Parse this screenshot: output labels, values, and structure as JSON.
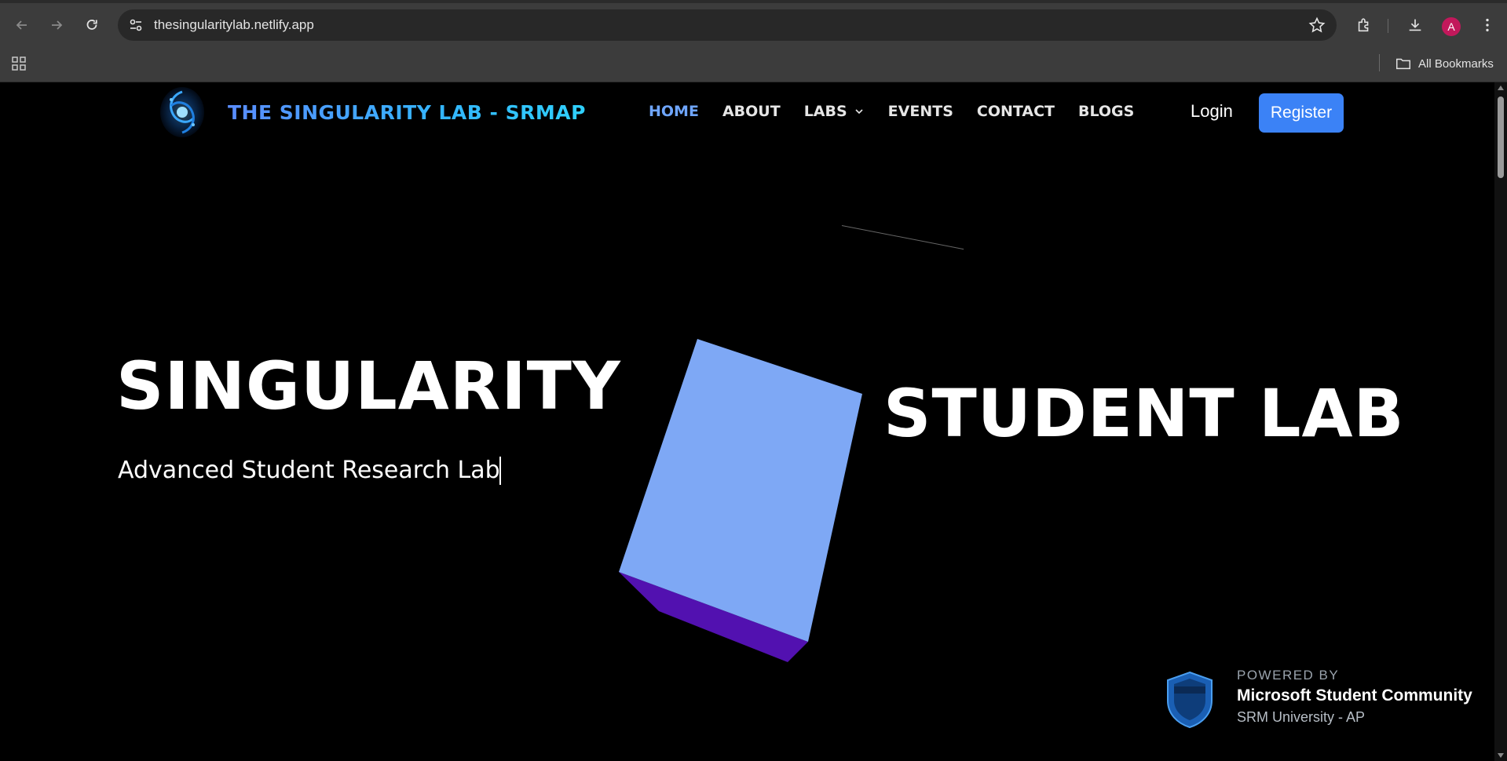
{
  "browser": {
    "url": "thesingularitylab.netlify.app",
    "profile_initial": "A",
    "bookmarks_label": "All Bookmarks",
    "icons": [
      "back-icon",
      "forward-icon",
      "reload-icon",
      "site-info-icon",
      "star-icon",
      "extensions-icon",
      "download-icon",
      "menu-icon",
      "apps-icon",
      "folder-icon"
    ]
  },
  "header": {
    "brand": "THE SINGULARITY LAB - SRMAP",
    "nav": [
      {
        "label": "HOME",
        "active": true
      },
      {
        "label": "ABOUT"
      },
      {
        "label": "LABS",
        "dropdown": true
      },
      {
        "label": "EVENTS"
      },
      {
        "label": "CONTACT"
      },
      {
        "label": "BLOGS"
      }
    ],
    "login": "Login",
    "register": "Register"
  },
  "hero": {
    "left_title": "SINGULARITY",
    "right_title": "STUDENT LAB",
    "tagline": "Advanced Student Research Lab"
  },
  "powered": {
    "label": "POWERED BY",
    "name": "Microsoft Student Community",
    "sub": "SRM University - AP"
  },
  "colors": {
    "accent": "#3b82f6",
    "nav_active": "#6fa6ff",
    "cube_top": "#7ea8f5",
    "cube_side": "#5211b0",
    "background": "#000000"
  }
}
